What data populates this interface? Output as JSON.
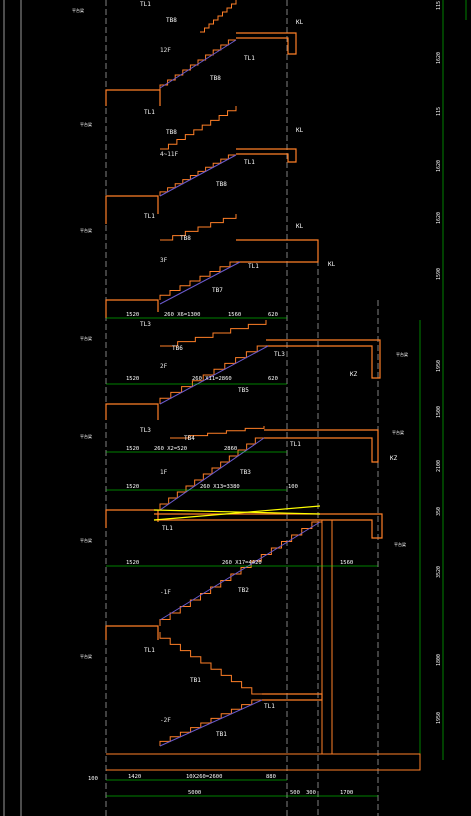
{
  "colors": {
    "background": "#000000",
    "structure": "#ff7f27",
    "stair_diagonal": "#6a5acd",
    "axis": "#ffffff",
    "dimension": "#00ff00",
    "leader": "#00ff00",
    "highlight": "#ffff00"
  },
  "floor_labels": [
    "12F",
    "4~11F",
    "3F",
    "2F",
    "1F",
    "-1F",
    "-2F"
  ],
  "member_labels": {
    "tl1": "TL1",
    "tl3": "TL3",
    "kl": "KL",
    "kz": "KZ",
    "tb1": "TB1",
    "tb2": "TB2",
    "tb3": "TB3",
    "tb4": "TB4",
    "tb5": "TB5",
    "tb6": "TB6",
    "tb7": "TB7",
    "tb8": "TB8",
    "tb8b": "TB8",
    "tb8c": "TB8",
    "tb9": "TB8",
    "tb10": "TB8",
    "pt": "平台梁"
  },
  "dimensions": {
    "f2_upper": [
      "1520",
      "260 X6=1300",
      "1560",
      "620"
    ],
    "f2_lower": [
      "1520",
      "260 X11=2860",
      "620"
    ],
    "f1_upper": [
      "1520",
      "260 X2=520",
      "2860"
    ],
    "f1_lower": [
      "1520",
      "260 X13=3380",
      "100"
    ],
    "b1": [
      "1520",
      "260 X17=4420",
      "1560"
    ],
    "bottom_run": [
      "100",
      "1420",
      "10X260=2600",
      "880"
    ],
    "bottom_total": [
      "5000",
      "500",
      "300",
      "1700"
    ]
  },
  "right_dims": [
    "115",
    "1620",
    "115",
    "1620",
    "1620",
    "1590",
    "1950",
    "1500",
    "2100",
    "350",
    "3520",
    "1800",
    "1950"
  ]
}
